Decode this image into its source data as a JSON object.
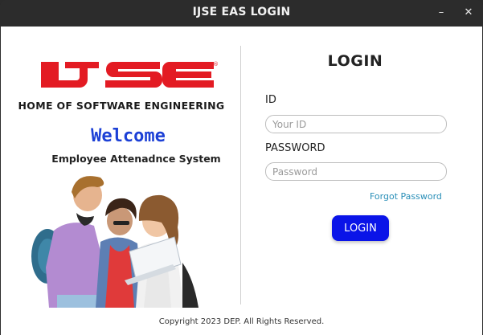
{
  "window": {
    "title": "IJSE EAS LOGIN",
    "minimize_glyph": "–",
    "close_glyph": "✕"
  },
  "brand": {
    "logo_text": "IJSE",
    "logo_mark": "®",
    "logo_color": "#e31b23",
    "tagline": "HOME OF SOFTWARE ENGINEERING"
  },
  "hero": {
    "welcome": "Welcome",
    "subtitle": "Employee Attenadnce System",
    "image_icon": "students-with-laptop-illustration"
  },
  "login": {
    "heading": "LOGIN",
    "id_label": "ID",
    "id_placeholder": "Your ID",
    "id_value": "",
    "password_label": "PASSWORD",
    "password_placeholder": "Password",
    "password_value": "",
    "forgot_link": "Forgot Password",
    "button_label": "LOGIN",
    "button_color": "#0a14e8"
  },
  "footer": {
    "copyright": "Copyright 2023 DEP. All Rights Reserved."
  }
}
